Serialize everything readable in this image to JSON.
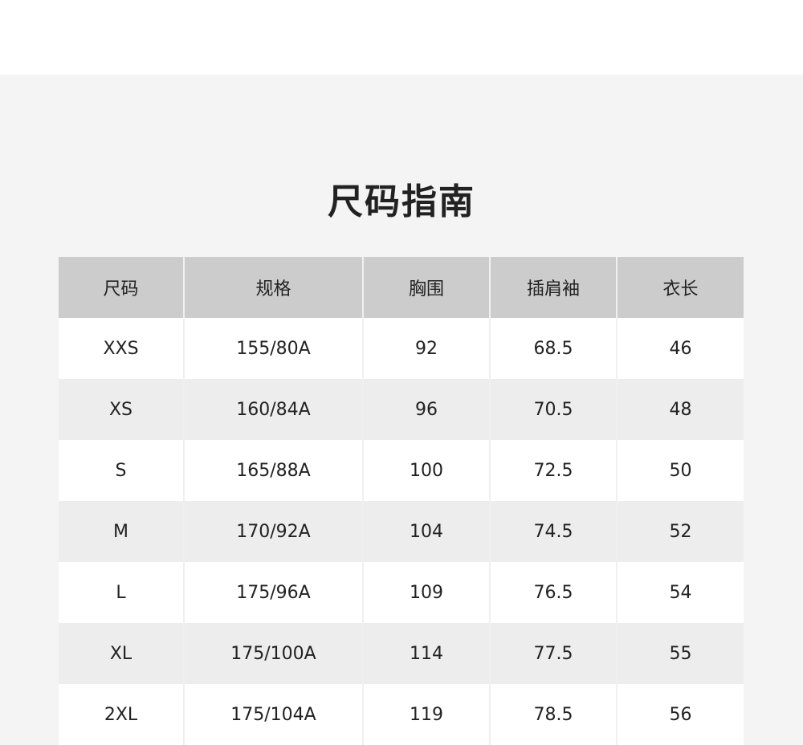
{
  "title": "尺码指南",
  "table": {
    "headers": [
      "尺码",
      "规格",
      "胸围",
      "插肩袖",
      "衣长"
    ],
    "rows": [
      [
        "XXS",
        "155/80A",
        "92",
        "68.5",
        "46"
      ],
      [
        "XS",
        "160/84A",
        "96",
        "70.5",
        "48"
      ],
      [
        "S",
        "165/88A",
        "100",
        "72.5",
        "50"
      ],
      [
        "M",
        "170/92A",
        "104",
        "74.5",
        "52"
      ],
      [
        "L",
        "175/96A",
        "109",
        "76.5",
        "54"
      ],
      [
        "XL",
        "175/100A",
        "114",
        "77.5",
        "55"
      ],
      [
        "2XL",
        "175/104A",
        "119",
        "78.5",
        "56"
      ]
    ]
  },
  "colors": {
    "header_bg": "#cccccc",
    "row_alt_bg": "#ededed",
    "page_bg": "#f4f4f4",
    "text": "#222222"
  }
}
